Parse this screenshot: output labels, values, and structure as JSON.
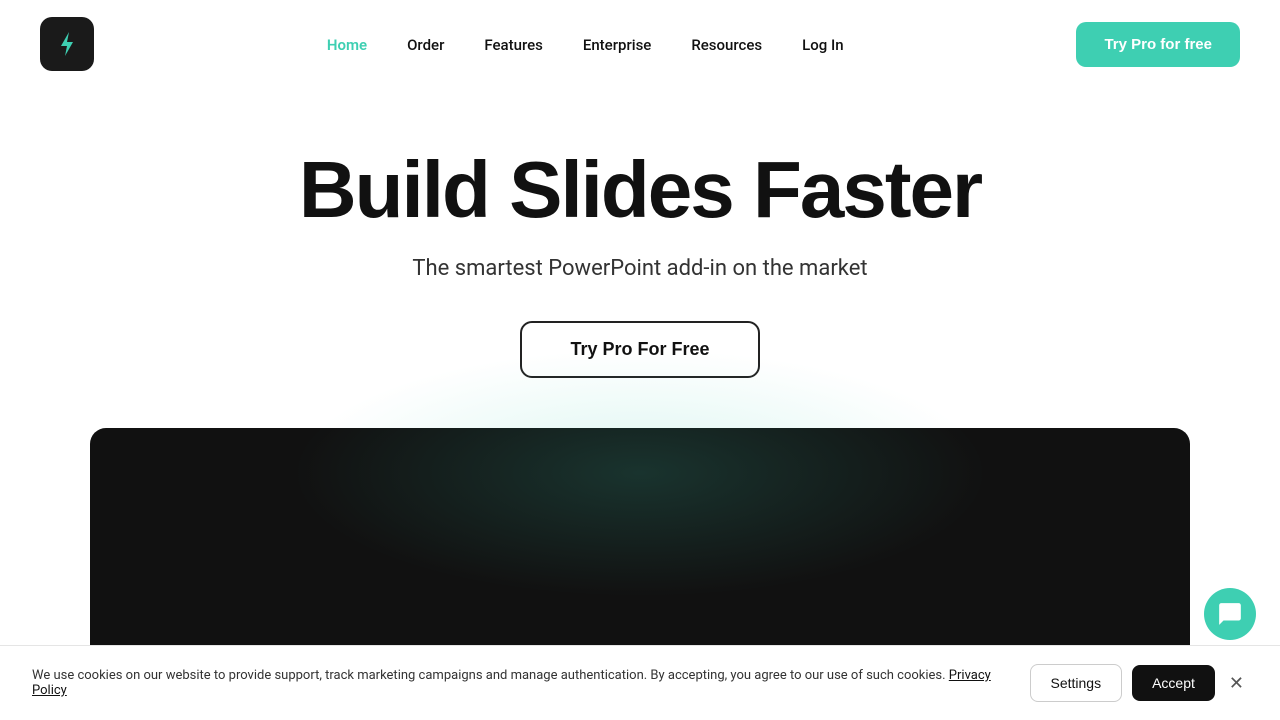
{
  "nav": {
    "logo_alt": "auxi logo",
    "links": [
      {
        "label": "Home",
        "active": true
      },
      {
        "label": "Order",
        "active": false
      },
      {
        "label": "Features",
        "active": false
      },
      {
        "label": "Enterprise",
        "active": false
      },
      {
        "label": "Resources",
        "active": false
      },
      {
        "label": "Log In",
        "active": false
      }
    ],
    "cta_label": "Try Pro for free"
  },
  "hero": {
    "title": "Build Slides Faster",
    "subtitle": "The smartest PowerPoint add-in on the market",
    "cta_label": "Try Pro For Free"
  },
  "cookie": {
    "message": "We use cookies on our website to provide support, track marketing campaigns and manage authentication. By accepting, you agree to our use of such cookies.",
    "privacy_link": "Privacy Policy",
    "settings_label": "Settings",
    "accept_label": "Accept"
  }
}
